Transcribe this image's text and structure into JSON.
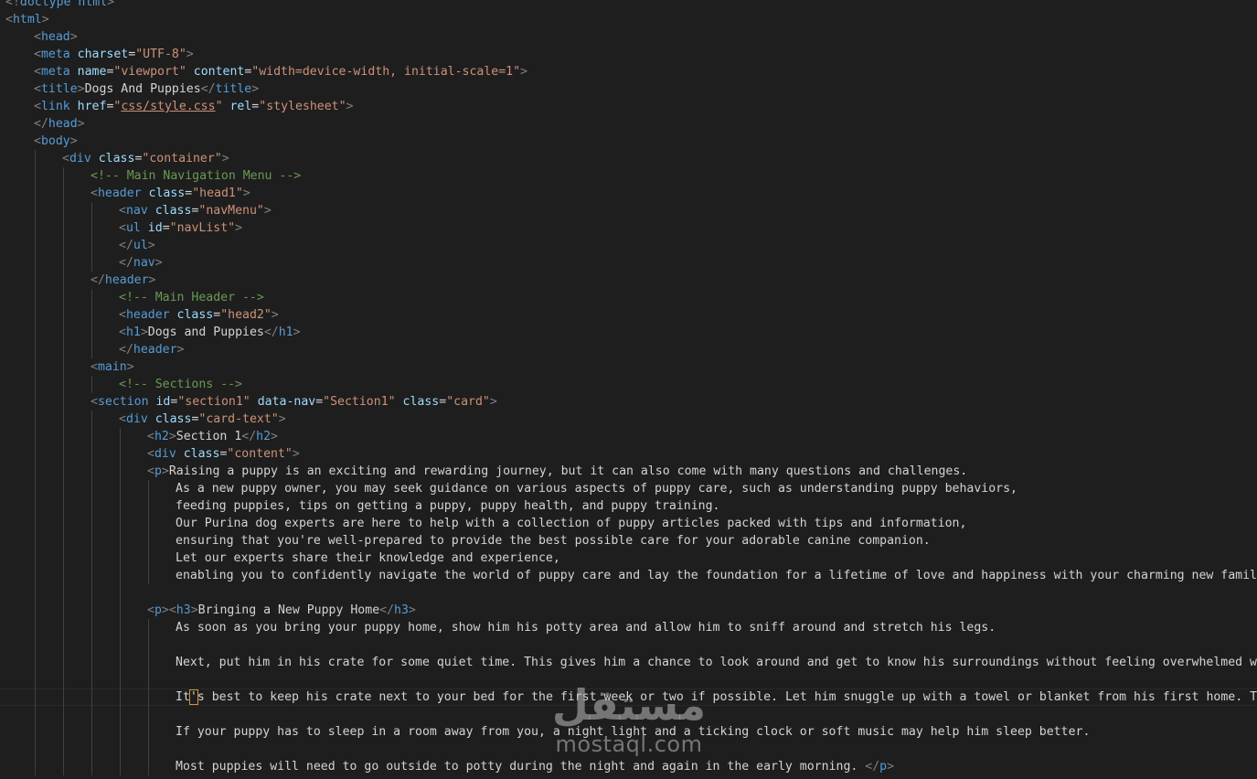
{
  "editor": {
    "language": "html",
    "theme_colors": {
      "background": "#1e1e1e",
      "tag": "#569cd6",
      "attribute": "#9cdcfe",
      "string": "#ce9178",
      "comment": "#6a9955",
      "text": "#d4d4d4",
      "punctuation": "#808080"
    },
    "lines": [
      {
        "indent": 0,
        "tokens": [
          [
            "p",
            "<!"
          ],
          [
            "d",
            "doctype html"
          ],
          [
            "p",
            ">"
          ]
        ]
      },
      {
        "indent": 0,
        "tokens": [
          [
            "p",
            "<"
          ],
          [
            "t",
            "html"
          ],
          [
            "p",
            ">"
          ]
        ]
      },
      {
        "indent": 1,
        "tokens": [
          [
            "p",
            "<"
          ],
          [
            "t",
            "head"
          ],
          [
            "p",
            ">"
          ]
        ]
      },
      {
        "indent": 1,
        "tokens": [
          [
            "p",
            "<"
          ],
          [
            "t",
            "meta"
          ],
          [
            "x",
            " "
          ],
          [
            "a",
            "charset"
          ],
          [
            "x",
            "="
          ],
          [
            "v",
            "\"UTF-8\""
          ],
          [
            "p",
            ">"
          ]
        ]
      },
      {
        "indent": 1,
        "tokens": [
          [
            "p",
            "<"
          ],
          [
            "t",
            "meta"
          ],
          [
            "x",
            " "
          ],
          [
            "a",
            "name"
          ],
          [
            "x",
            "="
          ],
          [
            "v",
            "\"viewport\""
          ],
          [
            "x",
            " "
          ],
          [
            "a",
            "content"
          ],
          [
            "x",
            "="
          ],
          [
            "v",
            "\"width=device-width, initial-scale=1\""
          ],
          [
            "p",
            ">"
          ]
        ]
      },
      {
        "indent": 1,
        "tokens": [
          [
            "p",
            "<"
          ],
          [
            "t",
            "title"
          ],
          [
            "p",
            ">"
          ],
          [
            "x",
            "Dogs And Puppies"
          ],
          [
            "p",
            "</"
          ],
          [
            "t",
            "title"
          ],
          [
            "p",
            ">"
          ]
        ]
      },
      {
        "indent": 1,
        "tokens": [
          [
            "p",
            "<"
          ],
          [
            "t",
            "link"
          ],
          [
            "x",
            " "
          ],
          [
            "a",
            "href"
          ],
          [
            "x",
            "="
          ],
          [
            "v",
            "\""
          ],
          [
            "l",
            "css/style.css"
          ],
          [
            "v",
            "\""
          ],
          [
            "x",
            " "
          ],
          [
            "a",
            "rel"
          ],
          [
            "x",
            "="
          ],
          [
            "v",
            "\"stylesheet\""
          ],
          [
            "p",
            ">"
          ]
        ]
      },
      {
        "indent": 1,
        "tokens": [
          [
            "p",
            "</"
          ],
          [
            "t",
            "head"
          ],
          [
            "p",
            ">"
          ]
        ]
      },
      {
        "indent": 1,
        "tokens": [
          [
            "p",
            "<"
          ],
          [
            "t",
            "body"
          ],
          [
            "p",
            ">"
          ]
        ]
      },
      {
        "indent": 2,
        "tokens": [
          [
            "p",
            "<"
          ],
          [
            "t",
            "div"
          ],
          [
            "x",
            " "
          ],
          [
            "a",
            "class"
          ],
          [
            "x",
            "="
          ],
          [
            "v",
            "\"container\""
          ],
          [
            "p",
            ">"
          ]
        ]
      },
      {
        "indent": 3,
        "tokens": [
          [
            "c",
            "<!-- Main Navigation Menu -->"
          ]
        ]
      },
      {
        "indent": 3,
        "tokens": [
          [
            "p",
            "<"
          ],
          [
            "t",
            "header"
          ],
          [
            "x",
            " "
          ],
          [
            "a",
            "class"
          ],
          [
            "x",
            "="
          ],
          [
            "v",
            "\"head1\""
          ],
          [
            "p",
            ">"
          ]
        ]
      },
      {
        "indent": 4,
        "tokens": [
          [
            "p",
            "<"
          ],
          [
            "t",
            "nav"
          ],
          [
            "x",
            " "
          ],
          [
            "a",
            "class"
          ],
          [
            "x",
            "="
          ],
          [
            "v",
            "\"navMenu\""
          ],
          [
            "p",
            ">"
          ]
        ]
      },
      {
        "indent": 4,
        "tokens": [
          [
            "p",
            "<"
          ],
          [
            "t",
            "ul"
          ],
          [
            "x",
            " "
          ],
          [
            "a",
            "id"
          ],
          [
            "x",
            "="
          ],
          [
            "v",
            "\"navList\""
          ],
          [
            "p",
            ">"
          ]
        ]
      },
      {
        "indent": 4,
        "tokens": [
          [
            "p",
            "</"
          ],
          [
            "t",
            "ul"
          ],
          [
            "p",
            ">"
          ]
        ]
      },
      {
        "indent": 4,
        "tokens": [
          [
            "p",
            "</"
          ],
          [
            "t",
            "nav"
          ],
          [
            "p",
            ">"
          ]
        ]
      },
      {
        "indent": 3,
        "tokens": [
          [
            "p",
            "</"
          ],
          [
            "t",
            "header"
          ],
          [
            "p",
            ">"
          ]
        ]
      },
      {
        "indent": 4,
        "tokens": [
          [
            "c",
            "<!-- Main Header -->"
          ]
        ]
      },
      {
        "indent": 4,
        "tokens": [
          [
            "p",
            "<"
          ],
          [
            "t",
            "header"
          ],
          [
            "x",
            " "
          ],
          [
            "a",
            "class"
          ],
          [
            "x",
            "="
          ],
          [
            "v",
            "\"head2\""
          ],
          [
            "p",
            ">"
          ]
        ]
      },
      {
        "indent": 4,
        "tokens": [
          [
            "p",
            "<"
          ],
          [
            "t",
            "h1"
          ],
          [
            "p",
            ">"
          ],
          [
            "x",
            "Dogs and Puppies"
          ],
          [
            "p",
            "</"
          ],
          [
            "t",
            "h1"
          ],
          [
            "p",
            ">"
          ]
        ]
      },
      {
        "indent": 4,
        "tokens": [
          [
            "p",
            "</"
          ],
          [
            "t",
            "header"
          ],
          [
            "p",
            ">"
          ]
        ]
      },
      {
        "indent": 3,
        "tokens": [
          [
            "p",
            "<"
          ],
          [
            "t",
            "main"
          ],
          [
            "p",
            ">"
          ]
        ]
      },
      {
        "indent": 4,
        "tokens": [
          [
            "c",
            "<!-- Sections -->"
          ]
        ]
      },
      {
        "indent": 3,
        "tokens": [
          [
            "p",
            "<"
          ],
          [
            "t",
            "section"
          ],
          [
            "x",
            " "
          ],
          [
            "a",
            "id"
          ],
          [
            "x",
            "="
          ],
          [
            "v",
            "\"section1\""
          ],
          [
            "x",
            " "
          ],
          [
            "a",
            "data-nav"
          ],
          [
            "x",
            "="
          ],
          [
            "v",
            "\"Section1\""
          ],
          [
            "x",
            " "
          ],
          [
            "a",
            "class"
          ],
          [
            "x",
            "="
          ],
          [
            "v",
            "\"card\""
          ],
          [
            "p",
            ">"
          ]
        ]
      },
      {
        "indent": 4,
        "tokens": [
          [
            "p",
            "<"
          ],
          [
            "t",
            "div"
          ],
          [
            "x",
            " "
          ],
          [
            "a",
            "class"
          ],
          [
            "x",
            "="
          ],
          [
            "v",
            "\"card-text\""
          ],
          [
            "p",
            ">"
          ]
        ]
      },
      {
        "indent": 5,
        "tokens": [
          [
            "p",
            "<"
          ],
          [
            "t",
            "h2"
          ],
          [
            "p",
            ">"
          ],
          [
            "x",
            "Section 1"
          ],
          [
            "p",
            "</"
          ],
          [
            "t",
            "h2"
          ],
          [
            "p",
            ">"
          ]
        ]
      },
      {
        "indent": 5,
        "tokens": [
          [
            "p",
            "<"
          ],
          [
            "t",
            "div"
          ],
          [
            "x",
            " "
          ],
          [
            "a",
            "class"
          ],
          [
            "x",
            "="
          ],
          [
            "v",
            "\"content\""
          ],
          [
            "p",
            ">"
          ]
        ]
      },
      {
        "indent": 5,
        "tokens": [
          [
            "p",
            "<"
          ],
          [
            "t",
            "p"
          ],
          [
            "p",
            ">"
          ],
          [
            "x",
            "Raising a puppy is an exciting and rewarding journey, but it can also come with many questions and challenges."
          ]
        ]
      },
      {
        "indent": 6,
        "tokens": [
          [
            "x",
            "As a new puppy owner, you may seek guidance on various aspects of puppy care, such as understanding puppy behaviors,"
          ]
        ]
      },
      {
        "indent": 6,
        "tokens": [
          [
            "x",
            "feeding puppies, tips on getting a puppy, puppy health, and puppy training."
          ]
        ]
      },
      {
        "indent": 6,
        "tokens": [
          [
            "x",
            "Our Purina dog experts are here to help with a collection of puppy articles packed with tips and information,"
          ]
        ]
      },
      {
        "indent": 6,
        "tokens": [
          [
            "x",
            "ensuring that you're well-prepared to provide the best possible care for your adorable canine companion."
          ]
        ]
      },
      {
        "indent": 6,
        "tokens": [
          [
            "x",
            "Let our experts share their knowledge and experience,"
          ]
        ]
      },
      {
        "indent": 6,
        "tokens": [
          [
            "x",
            "enabling you to confidently navigate the world of puppy care and lay the foundation for a lifetime of love and happiness with your charming new family mem"
          ]
        ]
      },
      {
        "indent": 6,
        "tokens": []
      },
      {
        "indent": 5,
        "tokens": [
          [
            "p",
            "<"
          ],
          [
            "t",
            "p"
          ],
          [
            "p",
            "><"
          ],
          [
            "t",
            "h3"
          ],
          [
            "p",
            ">"
          ],
          [
            "x",
            "Bringing a New Puppy Home"
          ],
          [
            "p",
            "</"
          ],
          [
            "t",
            "h3"
          ],
          [
            "p",
            ">"
          ]
        ]
      },
      {
        "indent": 6,
        "tokens": [
          [
            "x",
            "As soon as you bring your puppy home, show him his potty area and allow him to sniff around and stretch his legs."
          ]
        ]
      },
      {
        "indent": 6,
        "tokens": []
      },
      {
        "indent": 6,
        "tokens": [
          [
            "x",
            "Next, put him in his crate for some quiet time. This gives him a chance to look around and get to know his surroundings without feeling overwhelmed with n"
          ]
        ]
      },
      {
        "indent": 6,
        "tokens": []
      },
      {
        "indent": 6,
        "tokens": [
          [
            "x",
            "It"
          ],
          [
            "k",
            "'"
          ],
          [
            "x",
            "s best to keep his crate next to your bed for the first week or two if possible. Let him snuggle up with a towel or blanket from his first home. The fa"
          ]
        ]
      },
      {
        "indent": 6,
        "tokens": []
      },
      {
        "indent": 6,
        "tokens": [
          [
            "x",
            "If your puppy has to sleep in a room away from you, a night light and a ticking clock or soft music may help him sleep better."
          ]
        ]
      },
      {
        "indent": 6,
        "tokens": []
      },
      {
        "indent": 6,
        "tokens": [
          [
            "x",
            "Most puppies will need to go outside to potty during the night and again in the early morning. "
          ],
          [
            "p",
            "</"
          ],
          [
            "t",
            "p"
          ],
          [
            "p",
            ">"
          ]
        ]
      }
    ]
  },
  "watermark": {
    "arabic": "مستقل",
    "latin": "mostaql.com"
  }
}
